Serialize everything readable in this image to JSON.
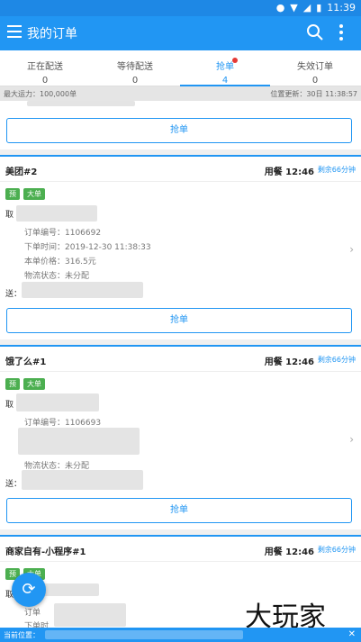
{
  "status_bar": {
    "time": "11:39"
  },
  "app_bar": {
    "title": "我的订单"
  },
  "tabs": [
    {
      "label": "正在配送",
      "count": "0"
    },
    {
      "label": "等待配送",
      "count": "0"
    },
    {
      "label": "抢单",
      "count": "4"
    },
    {
      "label": "失效订单",
      "count": "0"
    }
  ],
  "info_bar": {
    "capacity": "最大运力：100,000单",
    "updated": "位置更新：30日 11:38:57"
  },
  "top_grab_button": "抢单",
  "orders": [
    {
      "store": "美团#2",
      "meal": "用餐 12:46",
      "remaining": "剩余66分钟",
      "tags": [
        "预",
        "大单"
      ],
      "pickup_label": "取",
      "order_no": "订单编号：1106692",
      "order_time": "下单时间：2019-12-30 11:38:33",
      "price": "本单价格：316.5元",
      "logistics": "物流状态：未分配",
      "deliver_label": "送：",
      "grab_label": "抢单"
    },
    {
      "store": "饿了么#1",
      "meal": "用餐 12:46",
      "remaining": "剩余66分钟",
      "tags": [
        "预",
        "大单"
      ],
      "pickup_label": "取",
      "order_no": "订单编号：1106693",
      "logistics": "物流状态：未分配",
      "deliver_label": "送：",
      "grab_label": "抢单"
    },
    {
      "store": "商家自有-小程序#1",
      "meal": "用餐 12:46",
      "remaining": "剩余66分钟",
      "tags": [
        "预",
        "大单"
      ],
      "pickup_label": "取",
      "partial_1": "订单",
      "partial_2": "下单时"
    }
  ],
  "watermark": "大玩家",
  "bottom_bar": {
    "label": "当前位置："
  }
}
